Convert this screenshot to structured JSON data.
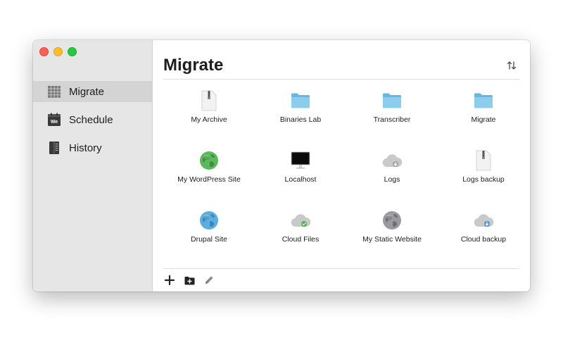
{
  "sidebar": {
    "items": [
      {
        "label": "Migrate",
        "icon": "grid-icon",
        "active": true
      },
      {
        "label": "Schedule",
        "icon": "calendar-icon",
        "active": false
      },
      {
        "label": "History",
        "icon": "ledger-icon",
        "active": false
      }
    ],
    "calendar_badge": "We"
  },
  "main": {
    "title": "Migrate",
    "sort_icon": "sort-arrows-icon",
    "tiles": [
      {
        "label": "My Archive",
        "icon": "archive-icon"
      },
      {
        "label": "Binaries Lab",
        "icon": "folder-icon"
      },
      {
        "label": "Transcriber",
        "icon": "folder-icon"
      },
      {
        "label": "Migrate",
        "icon": "folder-icon"
      },
      {
        "label": "My WordPress Site",
        "icon": "globe-green-icon"
      },
      {
        "label": "Localhost",
        "icon": "monitor-icon"
      },
      {
        "label": "Logs",
        "icon": "cloud-download-icon"
      },
      {
        "label": "Logs backup",
        "icon": "archive-icon"
      },
      {
        "label": "Drupal Site",
        "icon": "globe-blue-icon"
      },
      {
        "label": "Cloud Files",
        "icon": "cloud-green-icon"
      },
      {
        "label": "My Static Website",
        "icon": "globe-gray-icon"
      },
      {
        "label": "Cloud backup",
        "icon": "cloud-blue-icon"
      }
    ]
  },
  "toolbar": {
    "buttons": [
      {
        "icon": "plus-icon"
      },
      {
        "icon": "add-folder-icon"
      },
      {
        "icon": "pencil-icon"
      }
    ]
  },
  "colors": {
    "sidebar_bg": "#e6e6e6",
    "sidebar_active": "#d4d4d4",
    "folder": "#7ec4e6",
    "globe_green": "#4caf50",
    "globe_blue": "#4a9fd6",
    "globe_gray": "#8e8e93"
  }
}
